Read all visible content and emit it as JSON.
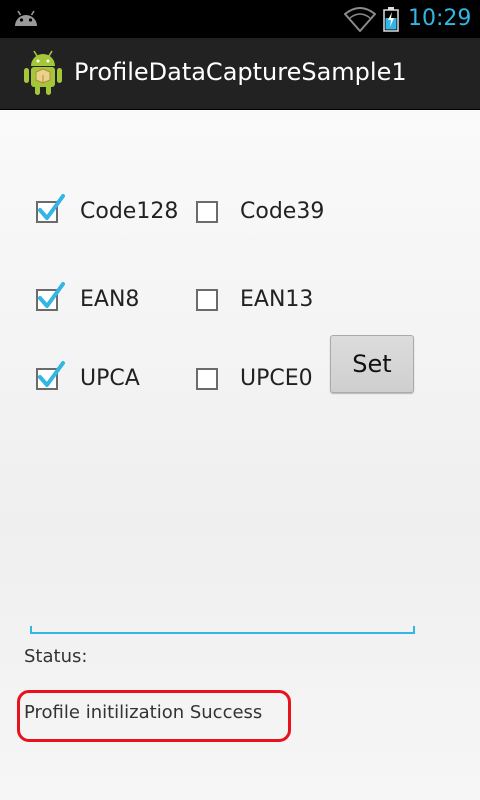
{
  "status_bar": {
    "time": "10:29",
    "icons": [
      "android-notification-icon",
      "wifi-icon",
      "battery-charging-icon"
    ],
    "clock_color": "#33b5e5"
  },
  "action_bar": {
    "title": "ProfileDataCaptureSample1",
    "icon": "android-app-icon"
  },
  "checkboxes": [
    {
      "label": "Code128",
      "checked": true
    },
    {
      "label": "Code39",
      "checked": false
    },
    {
      "label": "EAN8",
      "checked": true
    },
    {
      "label": "EAN13",
      "checked": false
    },
    {
      "label": "UPCA",
      "checked": true
    },
    {
      "label": "UPCE0",
      "checked": false
    }
  ],
  "set_button": {
    "label": "Set"
  },
  "text_field": {
    "value": ""
  },
  "status": {
    "label": "Status:",
    "value": "Profile initilization Success",
    "highlight_color": "#e8121d"
  },
  "colors": {
    "accent": "#33b5e5",
    "check": "#33b5e5"
  }
}
